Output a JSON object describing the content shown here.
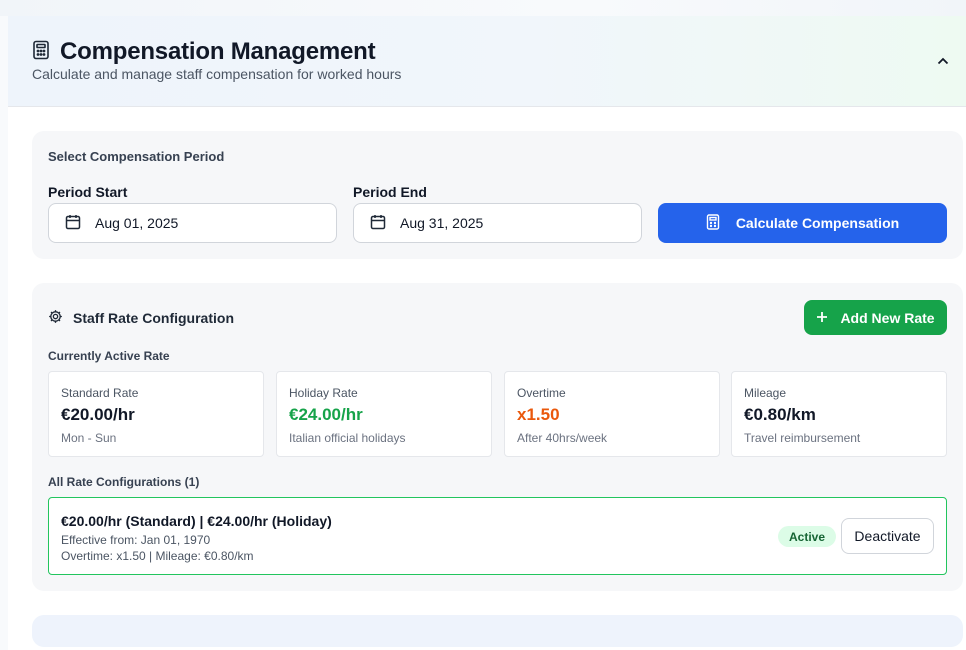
{
  "header": {
    "title": "Compensation Management",
    "subtitle": "Calculate and manage staff compensation for worked hours",
    "icon": "calculator-icon"
  },
  "period": {
    "section_label": "Select Compensation Period",
    "start_label": "Period Start",
    "start_value": "Aug 01, 2025",
    "end_label": "Period End",
    "end_value": "Aug 31, 2025",
    "calculate_label": "Calculate Compensation"
  },
  "rates": {
    "title": "Staff Rate Configuration",
    "add_label": "Add New Rate",
    "active_label": "Currently Active Rate",
    "cards": [
      {
        "label": "Standard Rate",
        "value": "€20.00/hr",
        "sub": "Mon - Sun",
        "color": "#111827"
      },
      {
        "label": "Holiday Rate",
        "value": "€24.00/hr",
        "sub": "Italian official holidays",
        "color": "#16a34a"
      },
      {
        "label": "Overtime",
        "value": "x1.50",
        "sub": "After 40hrs/week",
        "color": "#ea580c"
      },
      {
        "label": "Mileage",
        "value": "€0.80/km",
        "sub": "Travel reimbursement",
        "color": "#111827"
      }
    ],
    "all_label": "All Rate Configurations (1)",
    "configs": [
      {
        "summary": "€20.00/hr (Standard) | €24.00/hr (Holiday)",
        "effective": "Effective from: Jan 01, 1970",
        "details": "Overtime: x1.50 | Mileage: €0.80/km",
        "status": "Active",
        "action_label": "Deactivate"
      }
    ]
  },
  "colors": {
    "primary": "#2563eb",
    "success": "#16a34a",
    "overtime": "#ea580c"
  }
}
